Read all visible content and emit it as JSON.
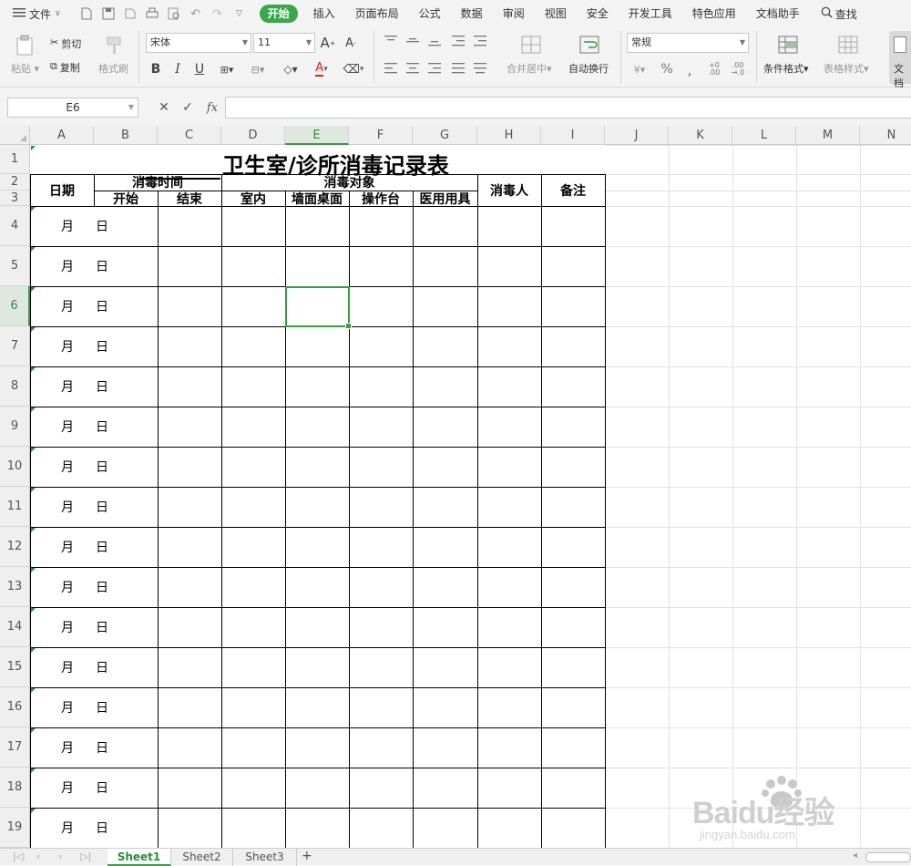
{
  "menubar": {
    "file_label": "文件",
    "tabs": [
      {
        "label": "开始",
        "active": true
      },
      {
        "label": "插入"
      },
      {
        "label": "页面布局"
      },
      {
        "label": "公式"
      },
      {
        "label": "数据"
      },
      {
        "label": "审阅"
      },
      {
        "label": "视图"
      },
      {
        "label": "安全"
      },
      {
        "label": "开发工具"
      },
      {
        "label": "特色应用"
      },
      {
        "label": "文档助手"
      }
    ],
    "search_label": "查找"
  },
  "ribbon": {
    "paste": "粘贴",
    "cut": "剪切",
    "copy": "复制",
    "format_painter": "格式刷",
    "font_name": "宋体",
    "font_size": "11",
    "merge_center": "合并居中",
    "wrap_text": "自动换行",
    "number_format": "常规",
    "conditional_format": "条件格式",
    "table_style": "表格样式",
    "doc": "文档"
  },
  "formulabar": {
    "cell_ref": "E6",
    "fx": "fx",
    "value": ""
  },
  "grid": {
    "columns": [
      "A",
      "B",
      "C",
      "D",
      "E",
      "F",
      "G",
      "H",
      "I",
      "J",
      "K",
      "L",
      "M",
      "N"
    ],
    "rows": [
      "1",
      "2",
      "3",
      "4",
      "5",
      "6",
      "7",
      "8",
      "9",
      "10",
      "11",
      "12",
      "13",
      "14",
      "15",
      "16",
      "17",
      "18",
      "19"
    ],
    "selected_col": "E",
    "selected_row": "6"
  },
  "sheet": {
    "title": "卫生室/诊所消毒记录表",
    "h_date": "日期",
    "h_time": "消毒时间",
    "h_start": "开始",
    "h_end": "结束",
    "h_target": "消毒对象",
    "h_indoor": "室内",
    "h_wall": "墙面桌面",
    "h_table": "操作台",
    "h_medical": "医用用具",
    "h_person": "消毒人",
    "h_note": "备注",
    "month": "月",
    "day": "日"
  },
  "sheets": [
    {
      "label": "Sheet1",
      "active": true
    },
    {
      "label": "Sheet2"
    },
    {
      "label": "Sheet3"
    }
  ],
  "watermark": {
    "text": "Baidu经验",
    "url": "jingyan.baidu.com"
  },
  "colors": {
    "accent": "#38a84b",
    "selection": "#3a9a47"
  }
}
